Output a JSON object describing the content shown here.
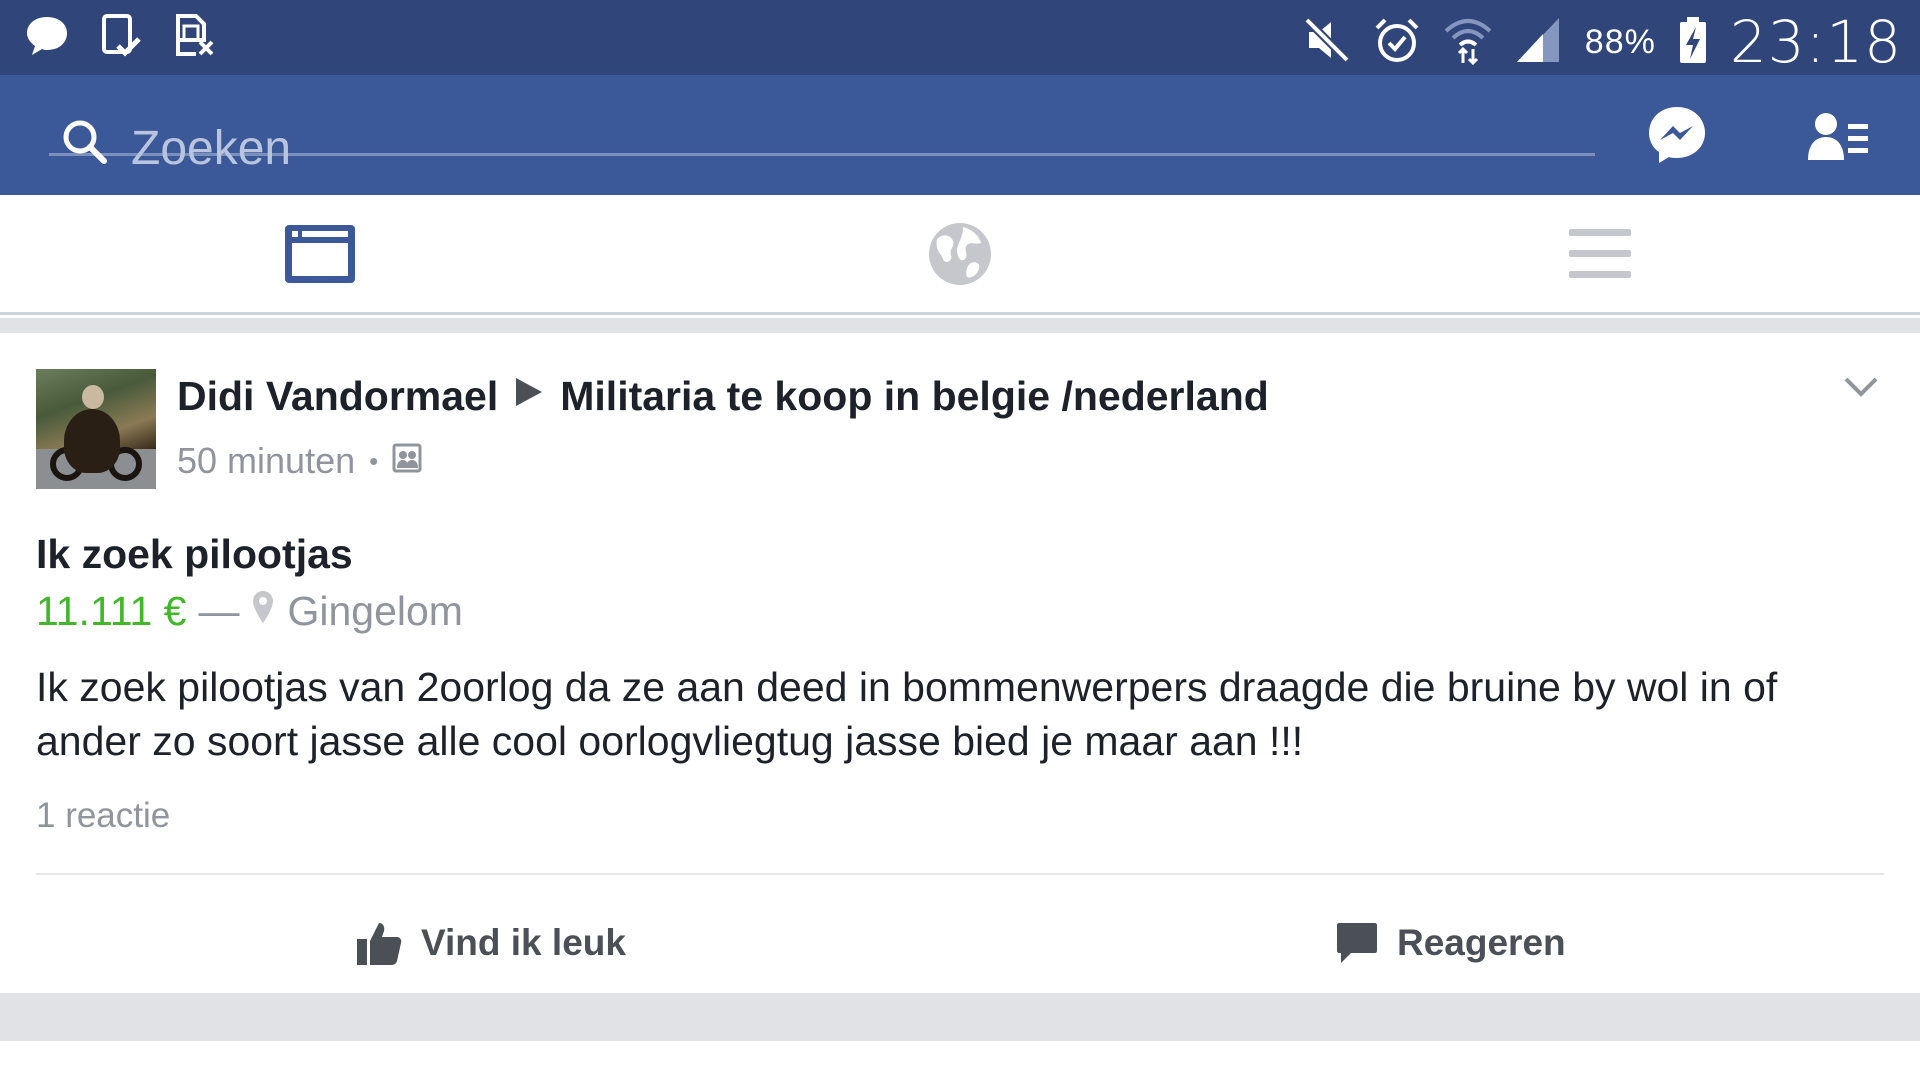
{
  "status_bar": {
    "battery_percent": "88%",
    "time": "23:18",
    "notification_icons": [
      "message-bubble-icon",
      "download-check-icon",
      "sim-card-error-icon"
    ],
    "system_icons": [
      "mute-icon",
      "alarm-icon",
      "wifi-icon",
      "signal-icon",
      "battery-charging-icon"
    ]
  },
  "search": {
    "placeholder": "Zoeken"
  },
  "tabs": [
    {
      "icon": "news-feed-icon",
      "active": true
    },
    {
      "icon": "globe-icon",
      "active": false
    },
    {
      "icon": "menu-icon",
      "active": false
    }
  ],
  "post": {
    "author": "Didi Vandormael",
    "group": "Militaria te koop in belgie /nederland",
    "time": "50 minuten",
    "separator": "•",
    "title": "Ik zoek pilootjas",
    "price": "11.111 €",
    "dash": "—",
    "location": "Gingelom",
    "body": "Ik zoek pilootjas van 2oorlog da ze aan deed in bommenwerpers draagde die bruine by wol in of ander zo soort jasse alle cool oorlogvliegtug jasse bied je maar aan !!!",
    "reactions": "1 reactie",
    "like_label": "Vind ik leuk",
    "comment_label": "Reageren"
  },
  "colors": {
    "status_bar": "#30467a",
    "brand_blue": "#3b5998",
    "price_green": "#42b72a",
    "muted_text": "#90949c",
    "feed_gap": "#e1e2e6"
  }
}
